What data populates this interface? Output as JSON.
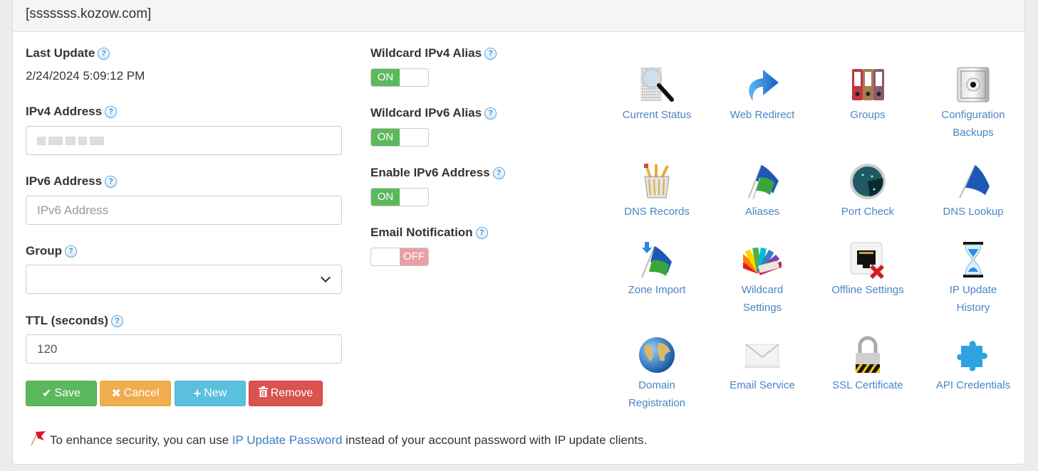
{
  "panel": {
    "title": "[sssssss.kozow.com]"
  },
  "form": {
    "last_update": {
      "label": "Last Update",
      "value": "2/24/2024 5:09:12 PM"
    },
    "ipv4": {
      "label": "IPv4 Address",
      "value": "(blurred)"
    },
    "ipv6": {
      "label": "IPv6 Address",
      "placeholder": "IPv6 Address",
      "value": ""
    },
    "group": {
      "label": "Group",
      "selected": ""
    },
    "ttl": {
      "label": "TTL (seconds)",
      "value": "120"
    }
  },
  "buttons": {
    "save": "Save",
    "cancel": "Cancel",
    "new": "New",
    "remove": "Remove"
  },
  "toggles": [
    {
      "label": "Wildcard IPv4 Alias",
      "state": "ON"
    },
    {
      "label": "Wildcard IPv6 Alias",
      "state": "ON"
    },
    {
      "label": "Enable IPv6 Address",
      "state": "ON"
    },
    {
      "label": "Email Notification",
      "state": "OFF"
    }
  ],
  "tiles": [
    {
      "label1": "Current Status",
      "label2": "",
      "icon": "magnifier-icon"
    },
    {
      "label1": "Web Redirect",
      "label2": "",
      "icon": "redirect-arrow-icon"
    },
    {
      "label1": "Groups",
      "label2": "",
      "icon": "binders-icon"
    },
    {
      "label1": "Configuration",
      "label2": "Backups",
      "icon": "safe-icon"
    },
    {
      "label1": "DNS Records",
      "label2": "",
      "icon": "pencil-cup-icon"
    },
    {
      "label1": "Aliases",
      "label2": "",
      "icon": "two-flags-icon"
    },
    {
      "label1": "Port Check",
      "label2": "",
      "icon": "radar-icon"
    },
    {
      "label1": "DNS Lookup",
      "label2": "",
      "icon": "blue-flag-icon"
    },
    {
      "label1": "Zone Import",
      "label2": "",
      "icon": "flag-import-icon"
    },
    {
      "label1": "Wildcard",
      "label2": "Settings",
      "icon": "color-fan-icon"
    },
    {
      "label1": "Offline Settings",
      "label2": "",
      "icon": "network-port-x-icon"
    },
    {
      "label1": "IP Update",
      "label2": "History",
      "icon": "hourglass-icon"
    },
    {
      "label1": "Domain",
      "label2": "Registration",
      "icon": "globe-icon"
    },
    {
      "label1": "Email Service",
      "label2": "",
      "icon": "envelope-icon"
    },
    {
      "label1": "SSL Certificate",
      "label2": "",
      "icon": "padlock-icon"
    },
    {
      "label1": "API Credentials",
      "label2": "",
      "icon": "puzzle-icon"
    }
  ],
  "note": {
    "before": "To enhance security, you can use ",
    "link": "IP Update Password",
    "after": " instead of your account password with IP update clients."
  },
  "colors": {
    "save": "#5cb85c",
    "cancel": "#f0ad4e",
    "new": "#5bc0de",
    "remove": "#d9534f",
    "toggle_on": "#5cb85c",
    "toggle_off": "#e8a1a3",
    "link": "#4a86c5"
  }
}
